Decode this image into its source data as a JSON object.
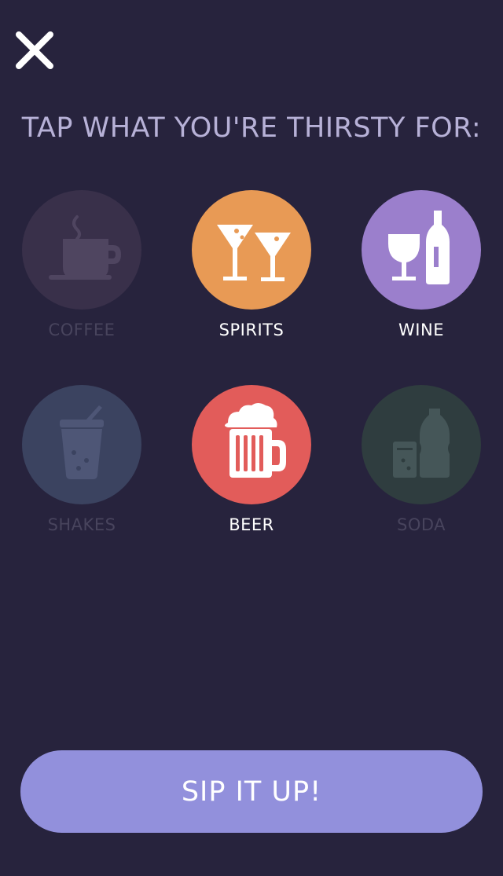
{
  "header": {
    "close_icon": "close-icon",
    "title": "TAP WHAT YOU'RE THIRSTY FOR:"
  },
  "drinks": [
    {
      "label": "COFFEE",
      "icon": "coffee-cup-icon",
      "selected": false,
      "color": "#39304a"
    },
    {
      "label": "SPIRITS",
      "icon": "martini-glasses-icon",
      "selected": true,
      "color": "#e89a55"
    },
    {
      "label": "WINE",
      "icon": "wine-glass-bottle-icon",
      "selected": true,
      "color": "#9b7fcc"
    },
    {
      "label": "SHAKES",
      "icon": "shake-cup-icon",
      "selected": false,
      "color": "#3b4360"
    },
    {
      "label": "BEER",
      "icon": "beer-mug-icon",
      "selected": true,
      "color": "#e25c5a"
    },
    {
      "label": "SODA",
      "icon": "soda-bottle-glass-icon",
      "selected": false,
      "color": "#2f3d3f"
    }
  ],
  "action": {
    "label": "SIP IT UP!",
    "color": "#9290dc"
  },
  "colors": {
    "background": "#27233d",
    "title": "#b7b1d7",
    "label_selected": "#ffffff",
    "label_unselected": "#48445d"
  }
}
